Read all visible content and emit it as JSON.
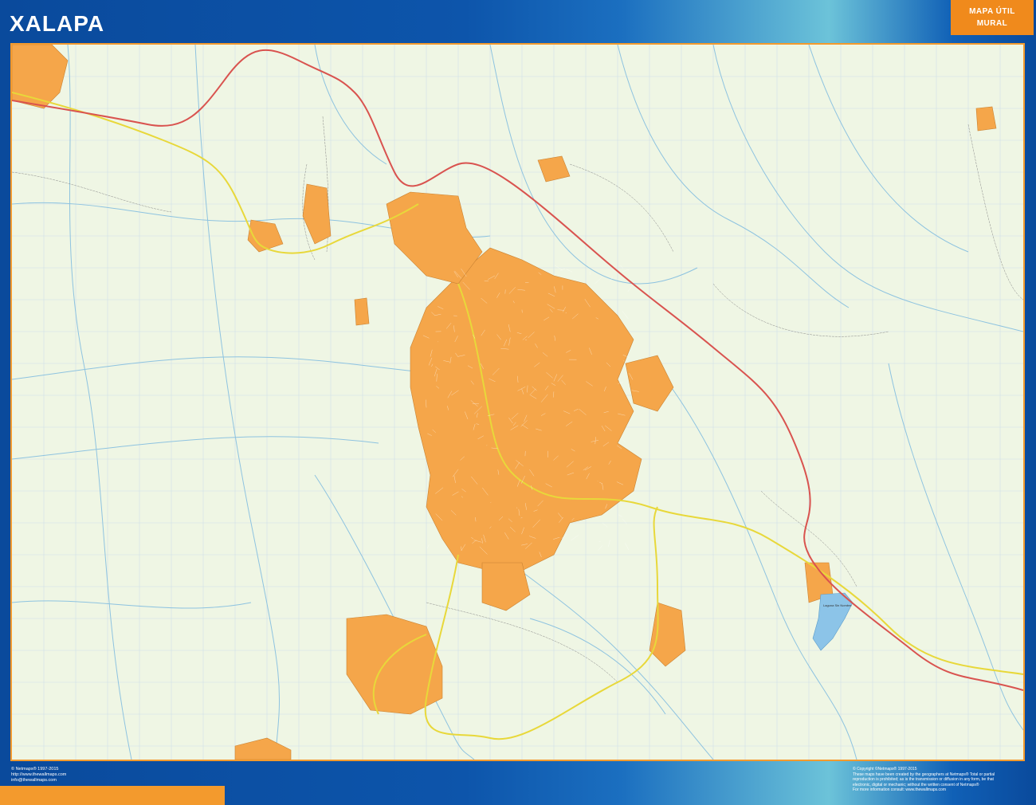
{
  "title": "XALAPA",
  "badge": {
    "line1": "MAPA ÚTIL",
    "line2": "MURAL"
  },
  "map": {
    "lake_label": "Laguna Sin Nombre",
    "colors": {
      "urban": "#f5a64a",
      "highway": "#d9534f",
      "primary_road": "#e8d83a",
      "river": "#8ec3e0",
      "background": "#eff6e4",
      "lake": "#8cc4e8"
    }
  },
  "footer_left": {
    "line1": "© Netmaps® 1997-2015",
    "line2": "http://www.thewallmaps.com",
    "line3": "info@thewallmaps.com"
  },
  "footer_right": {
    "line1": "© Copyright ©Netmaps® 1997-2015",
    "line2": "These maps have been created by the geographers at Netmaps® Total or partial",
    "line3": "reproduction is prohibited; as is the transmission or diffusion in any form, be that",
    "line4": "electronic, digital or mechanic; without the written consent of Netmaps®",
    "line5": "For more information consult: www.thewallmaps.com"
  }
}
